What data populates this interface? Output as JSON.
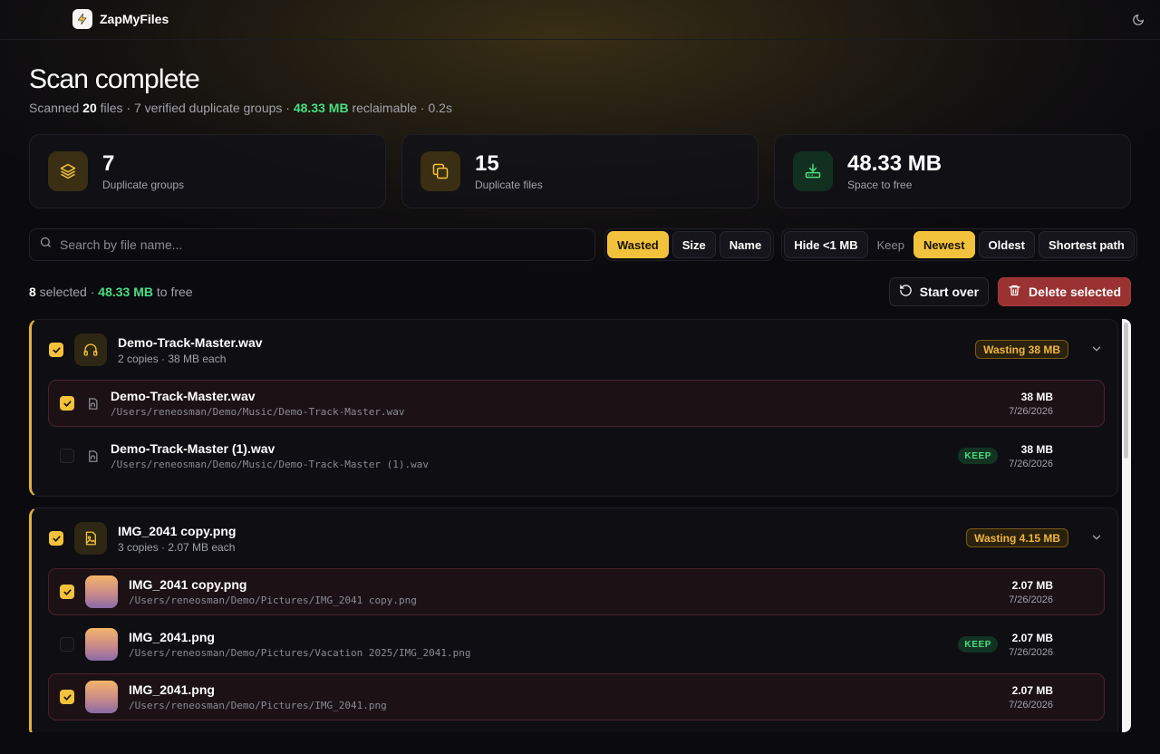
{
  "app": {
    "name": "ZapMyFiles"
  },
  "header": {
    "title": "Scan complete"
  },
  "summary": {
    "prefix": "Scanned ",
    "files_count": "20",
    "middle": " files · 7 verified duplicate groups · ",
    "reclaimable": "48.33 MB",
    "suffix": " reclaimable · 0.2s"
  },
  "stats": [
    {
      "value": "7",
      "label": "Duplicate groups",
      "icon": "layers-icon"
    },
    {
      "value": "15",
      "label": "Duplicate files",
      "icon": "copy-icon"
    },
    {
      "value": "48.33 MB",
      "label": "Space to free",
      "icon": "drive-download-icon"
    }
  ],
  "search": {
    "placeholder": "Search by file name..."
  },
  "sort": {
    "wasted": "Wasted",
    "size": "Size",
    "name": "Name",
    "active": "Wasted"
  },
  "filter": {
    "hide_small": "Hide <1 MB"
  },
  "keep": {
    "label": "Keep",
    "newest": "Newest",
    "oldest": "Oldest",
    "shortest": "Shortest path",
    "active": "Newest"
  },
  "selection": {
    "count": "8",
    "middle": " selected · ",
    "size": "48.33 MB",
    "suffix": " to free"
  },
  "actions": {
    "start_over": "Start over",
    "delete": "Delete selected"
  },
  "colors": {
    "accent": "#f3c23d",
    "danger": "#9b3232",
    "success": "#4ade80"
  },
  "groups": [
    {
      "name": "Demo-Track-Master.wav",
      "sub": "2 copies · 38 MB each",
      "wasting": "Wasting 38 MB",
      "icon": "headphones-icon",
      "files": [
        {
          "name": "Demo-Track-Master.wav",
          "path": "/Users/reneosman/Demo/Music/Demo-Track-Master.wav",
          "size": "38 MB",
          "date": "7/26/2026",
          "selected": true
        },
        {
          "name": "Demo-Track-Master (1).wav",
          "path": "/Users/reneosman/Demo/Music/Demo-Track-Master (1).wav",
          "size": "38 MB",
          "date": "7/26/2026",
          "selected": false,
          "badge": "KEEP"
        }
      ]
    },
    {
      "name": "IMG_2041 copy.png",
      "sub": "3 copies · 2.07 MB each",
      "wasting": "Wasting 4.15 MB",
      "icon": "image-file-icon",
      "files": [
        {
          "name": "IMG_2041 copy.png",
          "path": "/Users/reneosman/Demo/Pictures/IMG_2041 copy.png",
          "size": "2.07 MB",
          "date": "7/26/2026",
          "selected": true
        },
        {
          "name": "IMG_2041.png",
          "path": "/Users/reneosman/Demo/Pictures/Vacation 2025/IMG_2041.png",
          "size": "2.07 MB",
          "date": "7/26/2026",
          "selected": false,
          "badge": "KEEP"
        },
        {
          "name": "IMG_2041.png",
          "path": "/Users/reneosman/Demo/Pictures/IMG_2041.png",
          "size": "2.07 MB",
          "date": "7/26/2026",
          "selected": true
        }
      ]
    }
  ]
}
